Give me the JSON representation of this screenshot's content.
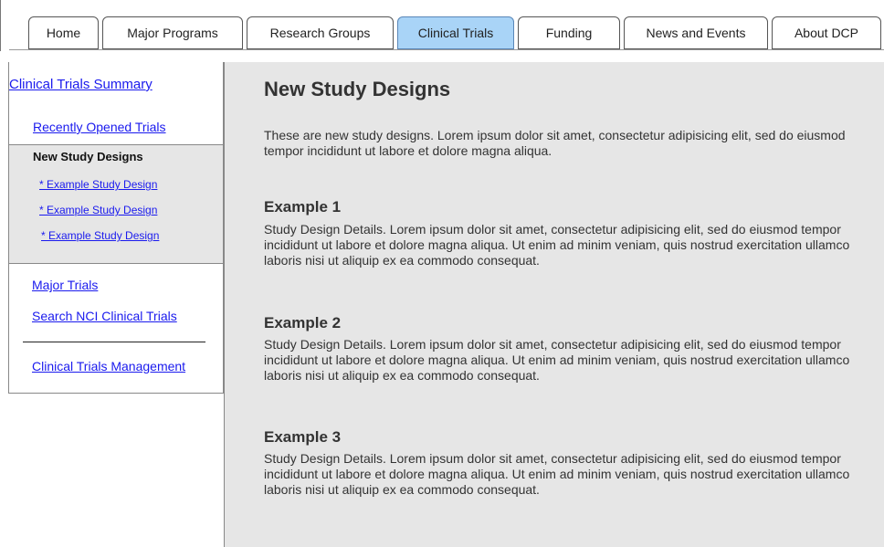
{
  "nav": {
    "tabs": [
      {
        "label": "Home",
        "active": false
      },
      {
        "label": "Major Programs",
        "active": false
      },
      {
        "label": "Research Groups",
        "active": false
      },
      {
        "label": "Clinical Trials",
        "active": true
      },
      {
        "label": "Funding",
        "active": false
      },
      {
        "label": "News and Events",
        "active": false
      },
      {
        "label": "About DCP",
        "active": false
      }
    ],
    "active_color": "#a9d4f7"
  },
  "sidebar": {
    "summary_link": "Clinical Trials Summary",
    "recently_opened": "Recently Opened Trials",
    "current_section": "New Study Designs",
    "sub_items": [
      "* Example Study Design",
      "* Example Study Design",
      "* Example Study Design"
    ],
    "major_trials": "Major Trials",
    "search_link": "Search NCI Clinical Trials",
    "management_link": "Clinical Trials Management"
  },
  "main": {
    "title": "New Study Designs",
    "intro": "These are new study designs.   Lorem ipsum dolor sit amet, consectetur adipisicing elit, sed do eiusmod tempor incididunt ut labore et dolore magna aliqua.",
    "examples": [
      {
        "heading": "Example 1",
        "body": "Study Design Details. Lorem ipsum dolor sit amet, consectetur adipisicing elit, sed do eiusmod tempor incididunt ut labore et dolore magna aliqua. Ut enim ad minim veniam, quis nostrud exercitation ullamco laboris nisi ut aliquip ex ea commodo consequat."
      },
      {
        "heading": "Example 2",
        "body": "Study Design Details. Lorem ipsum dolor sit amet, consectetur adipisicing elit, sed do eiusmod tempor incididunt ut labore et dolore magna aliqua. Ut enim ad minim veniam, quis nostrud exercitation ullamco laboris nisi ut aliquip ex ea commodo consequat."
      },
      {
        "heading": "Example 3",
        "body": "Study Design Details. Lorem ipsum dolor sit amet, consectetur adipisicing elit, sed do eiusmod tempor incididunt ut labore et dolore magna aliqua. Ut enim ad minim veniam, quis nostrud exercitation ullamco laboris nisi ut aliquip ex ea commodo consequat."
      }
    ]
  },
  "colors": {
    "link": "#1a1aee",
    "content_bg": "#e6e6e6"
  }
}
